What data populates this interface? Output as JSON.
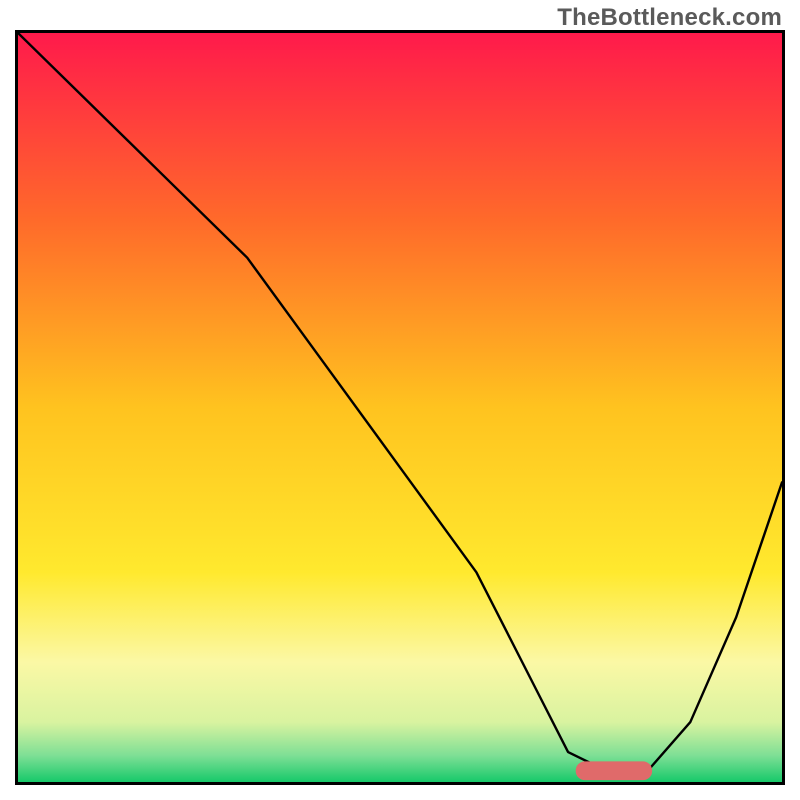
{
  "watermark": "TheBottleneck.com",
  "chart_data": {
    "type": "line",
    "title": "",
    "xlabel": "",
    "ylabel": "",
    "xlim": [
      0,
      100
    ],
    "ylim": [
      0,
      100
    ],
    "grid": false,
    "legend": false,
    "gradient_stops": [
      {
        "offset": 0.0,
        "color": "#ff1a4b"
      },
      {
        "offset": 0.25,
        "color": "#ff6a2a"
      },
      {
        "offset": 0.5,
        "color": "#ffc31f"
      },
      {
        "offset": 0.72,
        "color": "#ffe92e"
      },
      {
        "offset": 0.84,
        "color": "#fbf8a5"
      },
      {
        "offset": 0.92,
        "color": "#d9f3a0"
      },
      {
        "offset": 0.965,
        "color": "#7ddf95"
      },
      {
        "offset": 1.0,
        "color": "#17c96a"
      }
    ],
    "series": [
      {
        "name": "bottleneck-curve",
        "color": "#000000",
        "x": [
          0,
          10,
          20,
          30,
          40,
          50,
          60,
          68,
          72,
          78,
          82,
          88,
          94,
          100
        ],
        "y": [
          100,
          90,
          80,
          70,
          56,
          42,
          28,
          12,
          4,
          1,
          1,
          8,
          22,
          40
        ]
      }
    ],
    "marker": {
      "name": "optimal-range",
      "shape": "rounded-bar",
      "color": "#e06a6a",
      "x_start": 73,
      "x_end": 83,
      "y": 1.5,
      "height": 2.5
    }
  }
}
